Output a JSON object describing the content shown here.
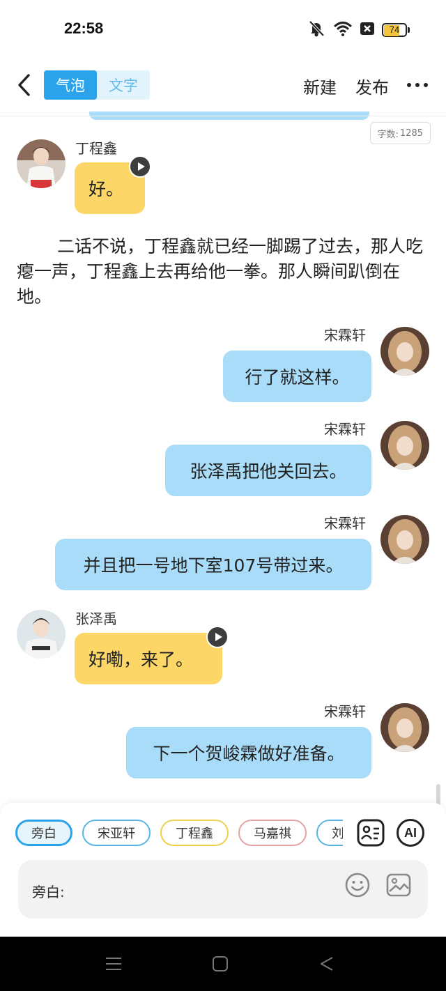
{
  "status_bar": {
    "time": "22:58",
    "icons": [
      "mute-bell-icon",
      "wifi-icon",
      "close-box-icon",
      "battery-icon"
    ],
    "battery": "74",
    "battery_level": 0.74
  },
  "topnav": {
    "back_icon": "chevron-left-icon",
    "segments": [
      {
        "label": "气泡",
        "active": true
      },
      {
        "label": "文字",
        "active": false
      }
    ],
    "new_label": "新建",
    "publish_label": "发布",
    "more_icon": "more-dots-icon"
  },
  "word_count": {
    "label": "字数:",
    "value": "1285"
  },
  "messages": [
    {
      "speaker": "丁程鑫",
      "side": "left",
      "text": "好。",
      "has_voice": true
    },
    {
      "speaker": "宋霖轩",
      "side": "right",
      "text": "行了就这样。"
    },
    {
      "speaker": "宋霖轩",
      "side": "right",
      "text": "张泽禹把他关回去。"
    },
    {
      "speaker": "宋霖轩",
      "side": "right",
      "text": "并且把一号地下室107号带过来。"
    },
    {
      "speaker": "张泽禹",
      "side": "left",
      "text": "好嘞，来了。",
      "has_voice": true
    },
    {
      "speaker": "宋霖轩",
      "side": "right",
      "text": "下一个贺峻霖做好准备。"
    }
  ],
  "narration": "二话不说，丁程鑫就已经一脚踢了过去，那人吃瘪一声，丁程鑫上去再给他一拳。那人瞬间趴倒在地。",
  "characters": [
    {
      "label": "旁白",
      "color": "#2ba3ea",
      "selected": true
    },
    {
      "label": "宋亚轩",
      "color": "#5ab6e6",
      "selected": false
    },
    {
      "label": "丁程鑫",
      "color": "#eed04a",
      "selected": false
    },
    {
      "label": "马嘉祺",
      "color": "#e3a3a3",
      "selected": false
    },
    {
      "label": "刘耀",
      "color": "#5ab6e6",
      "selected": false
    }
  ],
  "tools": {
    "card_icon": "character-card-icon",
    "ai_label": "AI"
  },
  "input": {
    "label": "旁白:",
    "emoji_icon": "emoji-icon",
    "image_icon": "image-icon"
  },
  "system_nav": [
    "menu-icon",
    "home-icon",
    "back-triangle-icon"
  ],
  "colors": {
    "accent": "#2ba3ea",
    "right_bubble": "#a9dcf8",
    "left_bubble": "#fcd768"
  }
}
